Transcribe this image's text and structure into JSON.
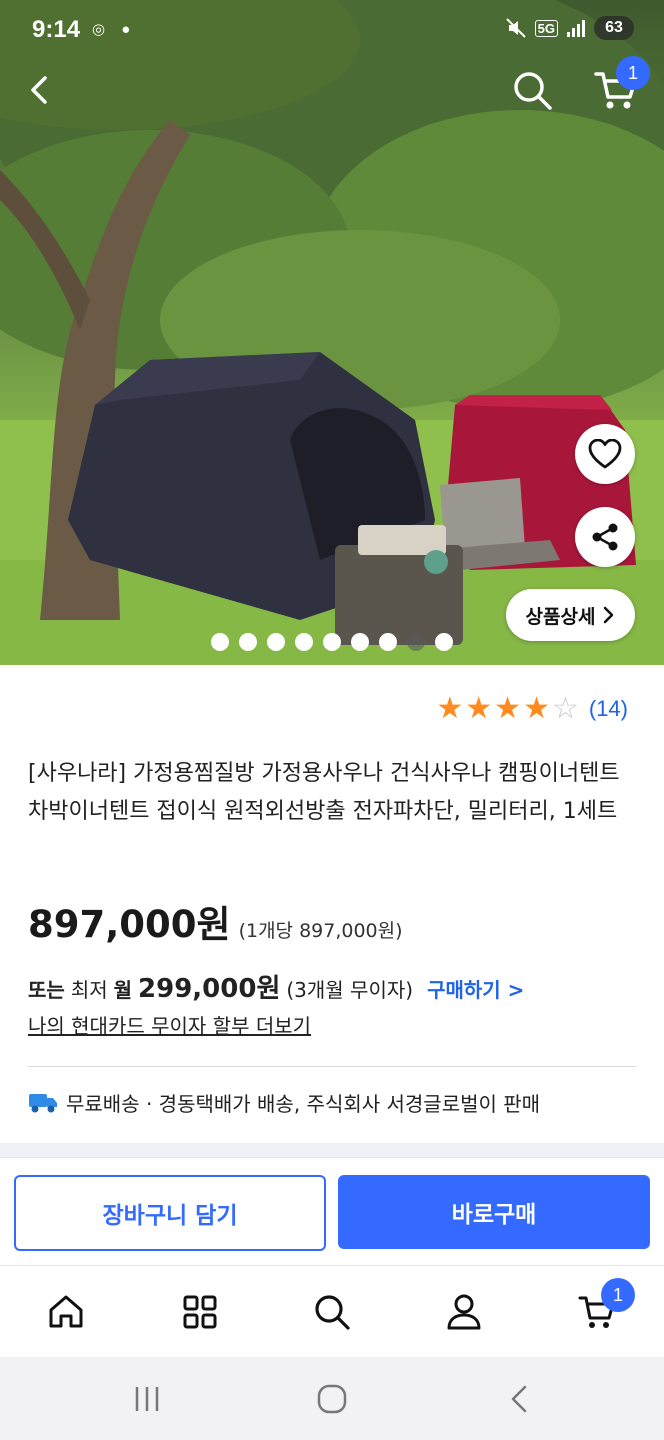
{
  "status_bar": {
    "time": "9:14",
    "app_icons": "◎ ●",
    "network": "5G",
    "battery": "63"
  },
  "header": {
    "cart_count": "1"
  },
  "gallery": {
    "detail_label": "상품상세",
    "slide_count": 9,
    "active_slide": 8
  },
  "rating": {
    "stars": 4,
    "count_label": "(14)"
  },
  "product": {
    "title": "[사우나라] 가정용찜질방 가정용사우나 건식사우나 캠핑이너텐트 차박이너텐트 접이식 원적외선방출 전자파차단, 밀리터리, 1세트",
    "price": "897,000원",
    "unit_price": "(1개당 897,000원)"
  },
  "installment": {
    "prefix": "또는",
    "lowest": "최저",
    "month": "월",
    "amount": "299,000원",
    "terms": "(3개월 무이자)",
    "buy_link": "구매하기 >",
    "card_link": "나의 현대카드 무이자 할부 더보기"
  },
  "shipping": {
    "text": "무료배송 · 경동택배가 배송, 주식회사 서경글로벌이 판매"
  },
  "actions": {
    "add_to_cart": "장바구니 담기",
    "buy_now": "바로구매"
  },
  "bottom_nav": {
    "cart_count": "1"
  },
  "colors": {
    "accent": "#346aff",
    "link": "#1e63e9",
    "star": "#ff8a1f"
  }
}
